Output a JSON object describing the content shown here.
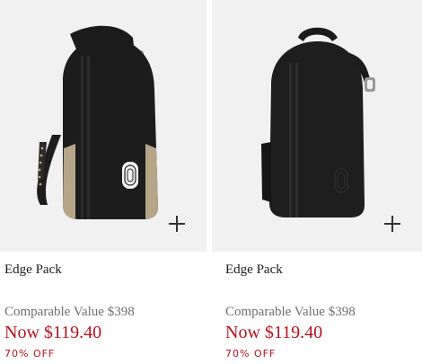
{
  "products": [
    {
      "name": "Edge Pack",
      "comparable_value": "Comparable Value $398",
      "now_price": "Now $119.40",
      "discount": "70% OFF",
      "colors": {
        "leather": "#1c1c1c",
        "accent": "#b7a588"
      }
    },
    {
      "name": "Edge Pack",
      "comparable_value": "Comparable Value $398",
      "now_price": "Now $119.40",
      "discount": "70% OFF",
      "colors": {
        "leather": "#1e1e1e"
      }
    }
  ],
  "icons": {
    "add": "plus-icon"
  },
  "accent_color": "#b3121f"
}
